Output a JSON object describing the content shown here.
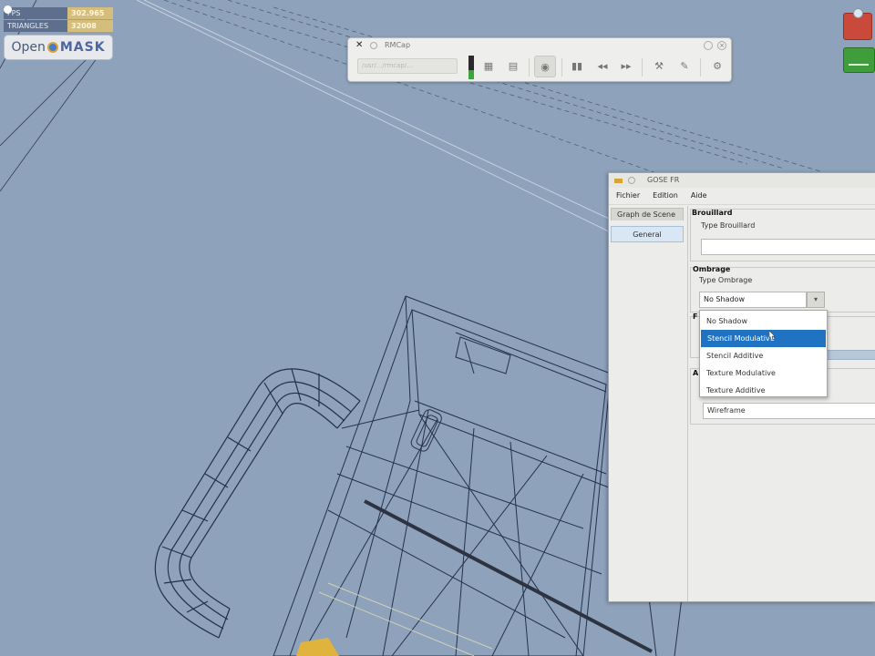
{
  "hud": {
    "rows": [
      {
        "label": "FPS",
        "value": "302.965"
      },
      {
        "label": "TRIANGLES",
        "value": "32008"
      }
    ],
    "logo": {
      "part1": "Open",
      "part2": "MASK"
    }
  },
  "toolbar": {
    "title": "RMCap",
    "field_text": "/usr/.../rmcap/...",
    "close": "×"
  },
  "settings_window": {
    "title": "GOSE FR",
    "menu": [
      "Fichier",
      "Edition",
      "Aide"
    ],
    "tab": "Graph de Scene",
    "nav_item": "General",
    "fog": {
      "title": "Brouillard",
      "type_label": "Type Brouillard",
      "value": ""
    },
    "shadow": {
      "title": "Ombrage",
      "type_label": "Type Ombrage",
      "selected": "No Shadow",
      "options": [
        "No Shadow",
        "Stencil Modulative",
        "Stencil Additive",
        "Texture Modulative",
        "Texture Additive"
      ],
      "highlighted_index": 1
    },
    "render_mode": {
      "title": "A",
      "value": "Wireframe"
    },
    "partial_label": "F"
  },
  "colors": {
    "desktop": "#8fa2bb",
    "selection": "#1f73c2"
  }
}
